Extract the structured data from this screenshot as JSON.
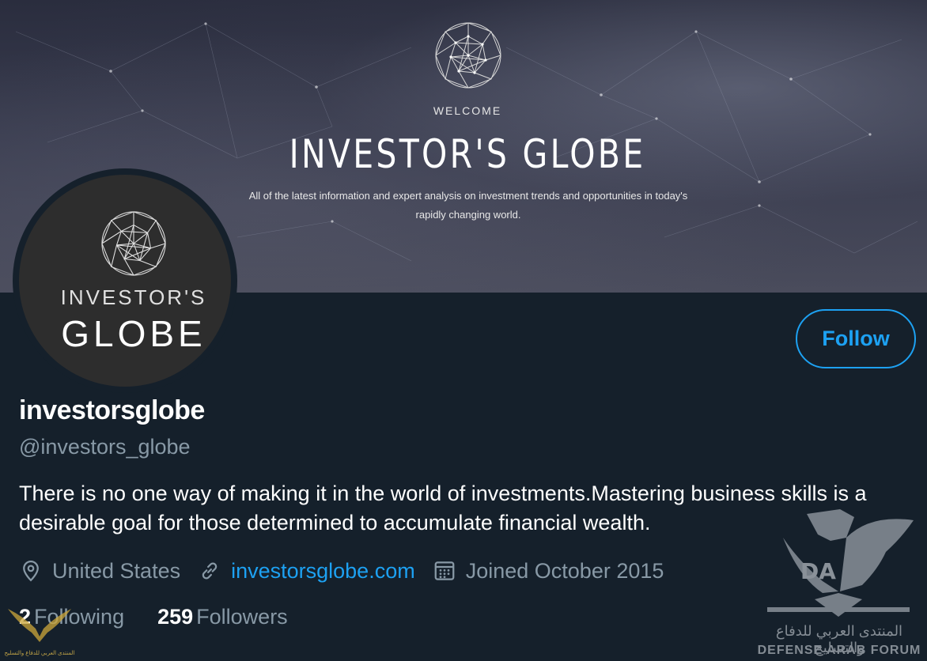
{
  "banner": {
    "welcome": "WELCOME",
    "title": "INVESTOR'S GLOBE",
    "description": "All of the latest information and expert analysis on investment trends and opportunities in today's rapidly changing world."
  },
  "avatar": {
    "line1": "INVESTOR'S",
    "line2": "GLOBE"
  },
  "follow_button": {
    "label": "Follow"
  },
  "profile": {
    "display_name": "investorsglobe",
    "handle": "@investors_globe",
    "bio": "There is no one way of making it in the world of investments.Mastering business skills is a desirable goal for those determined to accumulate financial wealth.",
    "location": "United States",
    "website": "investorsglobe.com",
    "joined": "Joined October 2015"
  },
  "stats": {
    "following_count": "2",
    "following_label": "Following",
    "followers_count": "259",
    "followers_label": "Followers"
  },
  "watermark": {
    "arabic": "المنتدى العربي للدفاع والتسليح",
    "english": "DEFENSE ARAB FORUM",
    "letters": "DA"
  },
  "colors": {
    "background": "#15202b",
    "accent": "#1da1f2",
    "secondary_text": "#8899a6"
  },
  "icons": [
    "location-pin-icon",
    "link-icon",
    "calendar-icon"
  ]
}
